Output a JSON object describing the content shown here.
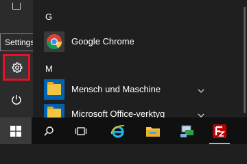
{
  "tooltip": {
    "text": "Settings"
  },
  "app_list": {
    "groups": [
      {
        "letter": "G",
        "apps": [
          {
            "label": "Google Chrome"
          }
        ]
      },
      {
        "letter": "M",
        "apps": [
          {
            "label": "Mensch und Maschine"
          },
          {
            "label": "Microsoft Office-verktyg"
          }
        ]
      }
    ]
  },
  "icons": {
    "rail": [
      "document-icon",
      "gear-icon",
      "power-icon"
    ],
    "taskbar": [
      "windows-start-icon",
      "search-icon",
      "task-view-icon",
      "internet-explorer-icon",
      "file-explorer-icon",
      "network-icon",
      "filezilla-icon"
    ]
  },
  "colors": {
    "highlight": "#e81123",
    "accent": "#0063b1",
    "taskbar": "#101010"
  }
}
